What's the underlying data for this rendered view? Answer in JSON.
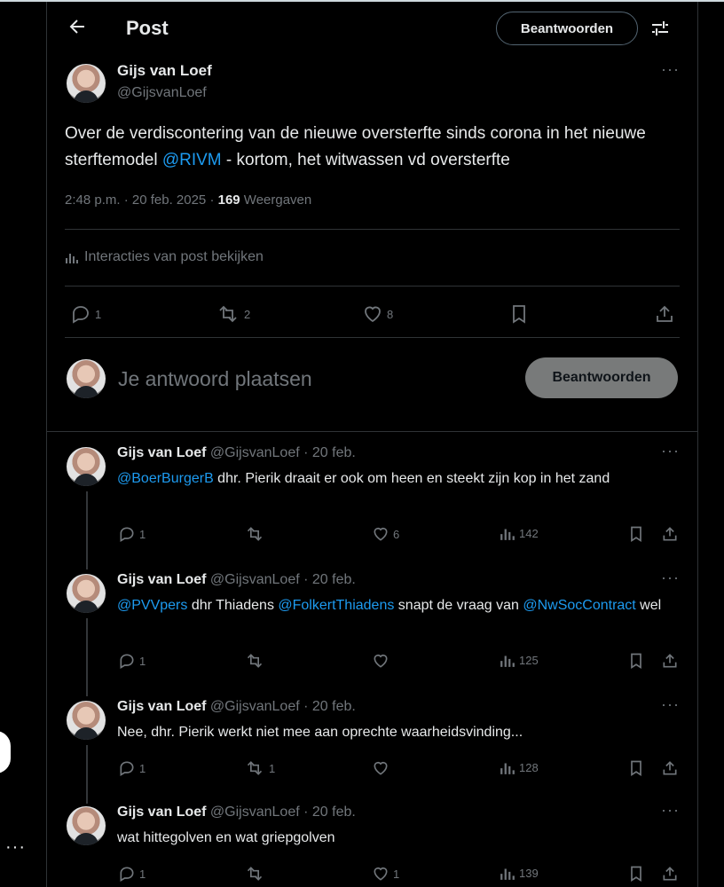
{
  "header": {
    "title": "Post",
    "reply_button": "Beantwoorden"
  },
  "main_post": {
    "author_name": "Gijs van Loef",
    "author_handle": "@GijsvanLoef",
    "text_before": "Over de verdiscontering van de nieuwe oversterfte sinds corona in het nieuwe sterftemodel ",
    "mention": "@RIVM",
    "text_after": " - kortom, het witwassen vd oversterfte",
    "timestamp": "2:48 p.m. · 20 feb. 2025 · ",
    "views_count": "169",
    "views_label": " Weergaven",
    "interactions_link": "Interacties van post bekijken",
    "replies": "1",
    "reposts": "2",
    "likes": "8"
  },
  "composer": {
    "placeholder": "Je antwoord plaatsen",
    "button": "Beantwoorden"
  },
  "replies": [
    {
      "name": "Gijs van Loef",
      "meta": "@GijsvanLoef · 20 feb.",
      "segments": [
        {
          "text": "@BoerBurgerB",
          "link": true
        },
        {
          "text": " dhr. Pierik draait er ook om heen en steekt zijn kop in het zand",
          "link": false
        }
      ],
      "replies": "1",
      "reposts": "",
      "likes": "6",
      "views": "142"
    },
    {
      "name": "Gijs van Loef",
      "meta": "@GijsvanLoef · 20 feb.",
      "segments": [
        {
          "text": "@PVVpers",
          "link": true
        },
        {
          "text": " dhr Thiadens ",
          "link": false
        },
        {
          "text": "@FolkertThiadens",
          "link": true
        },
        {
          "text": " snapt de vraag van ",
          "link": false
        },
        {
          "text": "@NwSocContract",
          "link": true
        },
        {
          "text": " wel",
          "link": false
        }
      ],
      "replies": "1",
      "reposts": "",
      "likes": "",
      "views": "125"
    },
    {
      "name": "Gijs van Loef",
      "meta": "@GijsvanLoef · 20 feb.",
      "segments": [
        {
          "text": "Nee, dhr. Pierik werkt niet mee aan oprechte waarheidsvinding...",
          "link": false
        }
      ],
      "replies": "1",
      "reposts": "1",
      "likes": "",
      "views": "128"
    },
    {
      "name": "Gijs van Loef",
      "meta": "@GijsvanLoef · 20 feb.",
      "segments": [
        {
          "text": "wat hittegolven en wat griepgolven",
          "link": false
        }
      ],
      "replies": "1",
      "reposts": "",
      "likes": "1",
      "views": "139"
    }
  ],
  "colors": {
    "background": "#000000",
    "text": "#e7e9ea",
    "muted": "#71767b",
    "link": "#1d9bf0",
    "border": "#2f3336"
  }
}
